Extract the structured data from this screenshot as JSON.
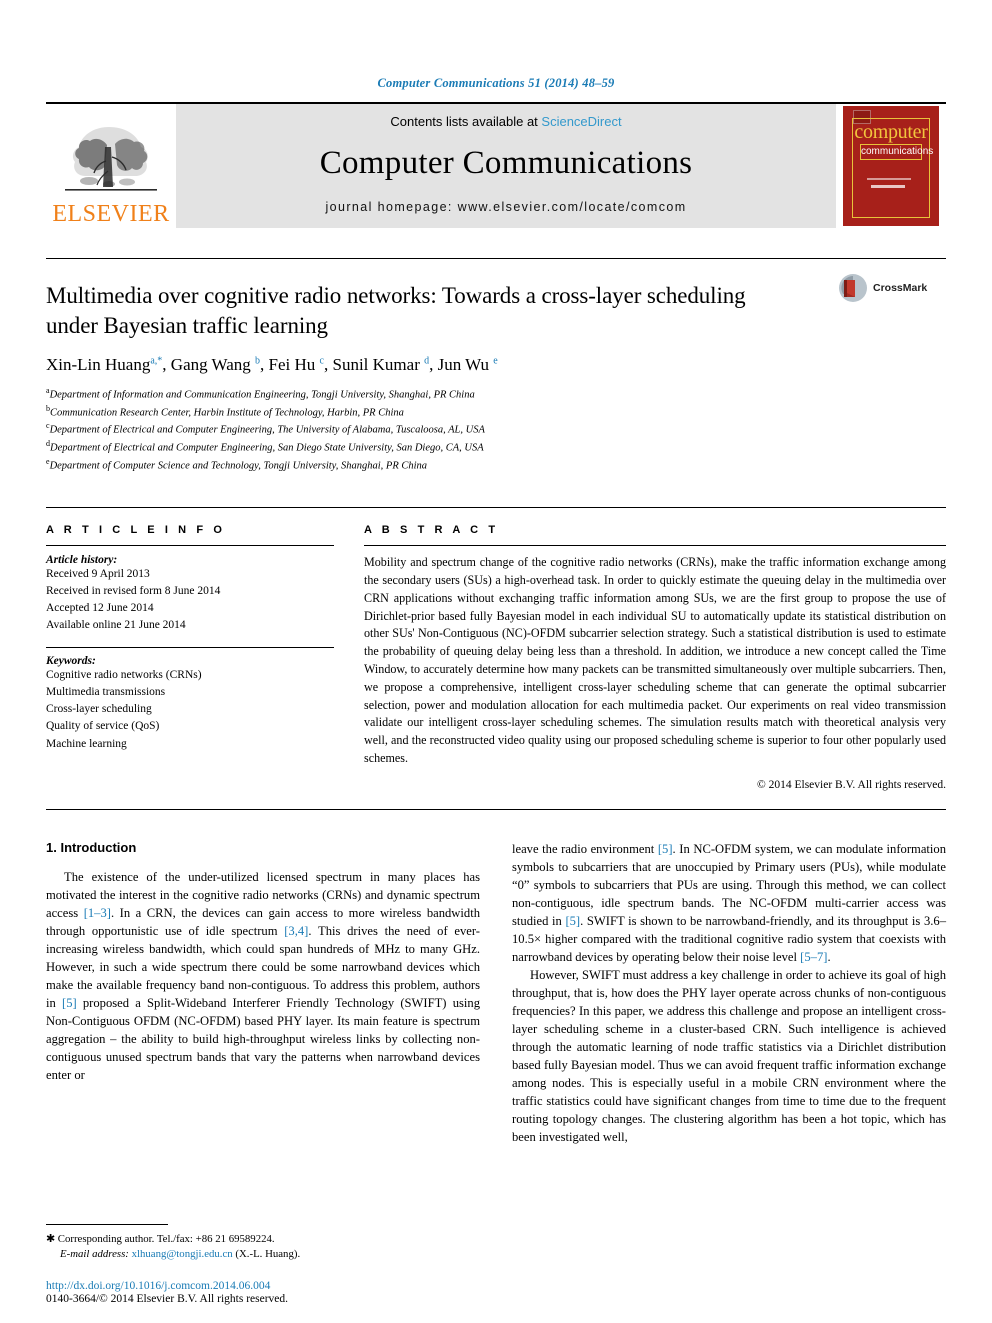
{
  "running_head": "Computer Communications 51 (2014) 48–59",
  "banner": {
    "publisher_name": "ELSEVIER",
    "contents_prefix": "Contents lists available at ",
    "sciencedirect": "ScienceDirect",
    "journal_title": "Computer Communications",
    "homepage": "journal homepage: www.elsevier.com/locate/comcom",
    "cover": {
      "line1": "computer",
      "line2": "communications"
    }
  },
  "crossmark": {
    "label": "CrossMark"
  },
  "article": {
    "title": "Multimedia over cognitive radio networks: Towards a cross-layer scheduling under Bayesian traffic learning",
    "authors": [
      {
        "name": "Xin-Lin Huang",
        "marks": "a,*"
      },
      {
        "name": "Gang Wang",
        "marks": "b"
      },
      {
        "name": "Fei Hu",
        "marks": "c"
      },
      {
        "name": "Sunil Kumar",
        "marks": "d"
      },
      {
        "name": "Jun Wu",
        "marks": "e"
      }
    ],
    "affiliations": [
      {
        "mark": "a",
        "text": "Department of Information and Communication Engineering, Tongji University, Shanghai, PR China"
      },
      {
        "mark": "b",
        "text": "Communication Research Center, Harbin Institute of Technology, Harbin, PR China"
      },
      {
        "mark": "c",
        "text": "Department of Electrical and Computer Engineering, The University of Alabama, Tuscaloosa, AL, USA"
      },
      {
        "mark": "d",
        "text": "Department of Electrical and Computer Engineering, San Diego State University, San Diego, CA, USA"
      },
      {
        "mark": "e",
        "text": "Department of Computer Science and Technology, Tongji University, Shanghai, PR China"
      }
    ]
  },
  "article_info": {
    "heading": "A R T I C L E   I N F O",
    "history_label": "Article history:",
    "history": [
      "Received 9 April 2013",
      "Received in revised form 8 June 2014",
      "Accepted 12 June 2014",
      "Available online 21 June 2014"
    ],
    "keywords_label": "Keywords:",
    "keywords": [
      "Cognitive radio networks (CRNs)",
      "Multimedia transmissions",
      "Cross-layer scheduling",
      "Quality of service (QoS)",
      "Machine learning"
    ]
  },
  "abstract": {
    "heading": "A B S T R A C T",
    "text": "Mobility and spectrum change of the cognitive radio networks (CRNs), make the traffic information exchange among the secondary users (SUs) a high-overhead task. In order to quickly estimate the queuing delay in the multimedia over CRN applications without exchanging traffic information among SUs, we are the first group to propose the use of Dirichlet-prior based fully Bayesian model in each individual SU to automatically update its statistical distribution on other SUs' Non-Contiguous (NC)-OFDM subcarrier selection strategy. Such a statistical distribution is used to estimate the probability of queuing delay being less than a threshold. In addition, we introduce a new concept called the Time Window, to accurately determine how many packets can be transmitted simultaneously over multiple subcarriers. Then, we propose a comprehensive, intelligent cross-layer scheduling scheme that can generate the optimal subcarrier selection, power and modulation allocation for each multimedia packet. Our experiments on real video transmission validate our intelligent cross-layer scheduling schemes. The simulation results match with theoretical analysis very well, and the reconstructed video quality using our proposed scheduling scheme is superior to four other popularly used schemes.",
    "copyright": "© 2014 Elsevier B.V. All rights reserved."
  },
  "body": {
    "section_heading": "1. Introduction",
    "left_paragraphs": [
      "The existence of the under-utilized licensed spectrum in many places has motivated the interest in the cognitive radio networks (CRNs) and dynamic spectrum access [1–3]. In a CRN, the devices can gain access to more wireless bandwidth through opportunistic use of idle spectrum [3,4]. This drives the need of ever-increasing wireless bandwidth, which could span hundreds of MHz to many GHz. However, in such a wide spectrum there could be some narrowband devices which make the available frequency band non-contiguous. To address this problem, authors in [5] proposed a Split-Wideband Interferer Friendly Technology (SWIFT) using Non-Contiguous OFDM (NC-OFDM) based PHY layer. Its main feature is spectrum aggregation – the ability to build high-throughput wireless links by collecting non-contiguous unused spectrum bands that vary the patterns when narrowband devices enter or"
    ],
    "right_paragraphs": [
      "leave the radio environment [5]. In NC-OFDM system, we can modulate information symbols to subcarriers that are unoccupied by Primary users (PUs), while modulate “0” symbols to subcarriers that PUs are using. Through this method, we can collect non-contiguous, idle spectrum bands. The NC-OFDM multi-carrier access was studied in [5]. SWIFT is shown to be narrowband-friendly, and its throughput is 3.6–10.5× higher compared with the traditional cognitive radio system that coexists with narrowband devices by operating below their noise level [5–7].",
      "However, SWIFT must address a key challenge in order to achieve its goal of high throughput, that is, how does the PHY layer operate across chunks of non-contiguous frequencies? In this paper, we address this challenge and propose an intelligent cross-layer scheduling scheme in a cluster-based CRN. Such intelligence is achieved through the automatic learning of node traffic statistics via a Dirichlet distribution based fully Bayesian model. Thus we can avoid frequent traffic information exchange among nodes. This is especially useful in a mobile CRN environment where the traffic statistics could have significant changes from time to time due to the frequent routing topology changes. The clustering algorithm has been a hot topic, which has been investigated well,"
    ]
  },
  "footnote": {
    "corresponding": "Corresponding author. Tel./fax: +86 21 69589224.",
    "email_label": "E-mail address:",
    "email": "xlhuang@tongji.edu.cn",
    "email_suffix": "(X.-L. Huang)."
  },
  "doi": {
    "url": "http://dx.doi.org/10.1016/j.comcom.2014.06.004",
    "issn_line": "0140-3664/© 2014 Elsevier B.V. All rights reserved."
  },
  "colors": {
    "link_blue": "#1a7bb5",
    "sciencedirect_blue": "#3399cc",
    "elsevier_orange": "#F08019",
    "cover_red": "#A7201A",
    "cover_yellow": "#F2C53D"
  }
}
